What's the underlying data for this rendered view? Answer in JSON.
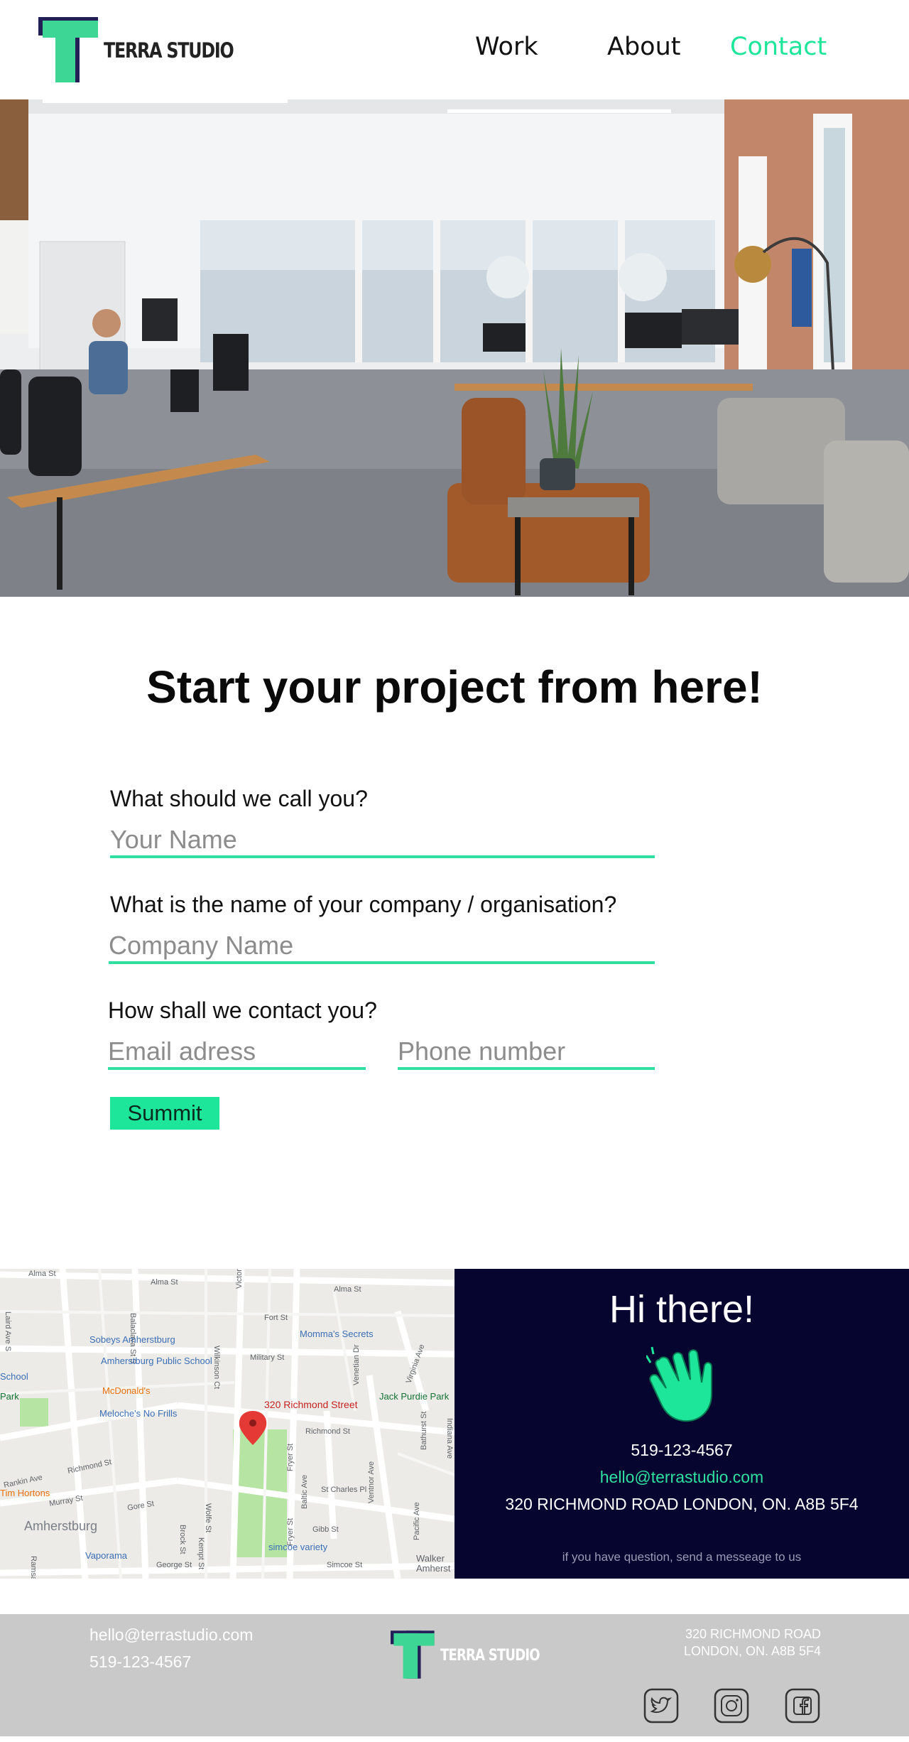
{
  "header": {
    "brand": "TERRA STUDIO",
    "nav": [
      {
        "label": "Work"
      },
      {
        "label": "About"
      },
      {
        "label": "Contact"
      }
    ],
    "accent": "#1de59a"
  },
  "form": {
    "headline": "Start your project from here!",
    "name_question": "What should we call you?",
    "name_placeholder": "Your Name",
    "company_question": "What is the name of your company / organisation?",
    "company_placeholder": "Company Name",
    "contact_question": "How shall we contact you?",
    "email_placeholder": "Email adress",
    "phone_placeholder": "Phone number",
    "submit_label": "Summit"
  },
  "map": {
    "pin_label": "320 Richmond Street",
    "streets": [
      "Alma St",
      "Alma St",
      "Alma St",
      "Fort St",
      "Military St",
      "Richmond St",
      "Richmond St",
      "Rankin Ave",
      "Murray St",
      "Gore St",
      "Simcoe St",
      "Fryer St",
      "Fryer St",
      "Victoria St",
      "St Charles Pl",
      "Baltic Ave",
      "Venetian Dr",
      "Virginia Ave",
      "Pacific Ave",
      "Ventnor Ave",
      "Bathurst St",
      "Balaclava St S",
      "Brock St",
      "Kempt St",
      "Wolfe St",
      "George St",
      "Ramsay St",
      "Gibb St",
      "Wilkinson Ct",
      "Laird Ave S",
      "Indiana Ave"
    ],
    "places": [
      "Sobeys Amherstburg",
      "Amherstburg Public School",
      "McDonald's",
      "Meloche's No Frills",
      "Momma's Secrets",
      "Jack Purdie Park",
      "simcoe variety",
      "Vaporama",
      "Amherstburg",
      "Walker",
      "Amherst",
      "Tim Hortons",
      "Park",
      "School"
    ]
  },
  "contact": {
    "greeting": "Hi there!",
    "phone": "519-123-4567",
    "email": "hello@terrastudio.com",
    "address": "320 RICHMOND ROAD LONDON, ON. A8B 5F4",
    "note": "if you have question, send a messeage to us",
    "background": "#050530"
  },
  "footer": {
    "email": "hello@terrastudio.com",
    "phone": "519-123-4567",
    "brand": "TERRA STUDIO",
    "address_line1": "320 RICHMOND ROAD",
    "address_line2": "LONDON, ON. A8B 5F4",
    "social_icons": [
      "twitter-icon",
      "instagram-icon",
      "facebook-icon"
    ],
    "background": "#c9c9c9"
  }
}
